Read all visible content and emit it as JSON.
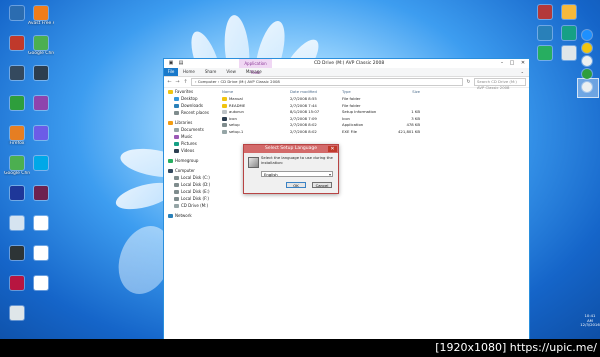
{
  "desktop": {
    "left_icons": [
      {
        "label": "",
        "icon": "app-icon",
        "color": "#2b6cb0"
      },
      {
        "label": "Avast Free Antivirus",
        "icon": "avast-icon",
        "color": "#f07d1a"
      },
      {
        "label": "",
        "icon": "app-icon",
        "color": "#c0392b"
      },
      {
        "label": "Google Chrome",
        "icon": "chrome-icon",
        "color": "#4caf50"
      },
      {
        "label": "",
        "icon": "app-icon",
        "color": "#34495e"
      },
      {
        "label": "",
        "icon": "app-icon",
        "color": "#2c3e50"
      },
      {
        "label": "",
        "icon": "utorrent-icon",
        "color": "#2e9e3c"
      },
      {
        "label": "",
        "icon": "app-icon",
        "color": "#8e44ad"
      },
      {
        "label": "Firefox",
        "icon": "firefox-icon",
        "color": "#e67e22"
      },
      {
        "label": "",
        "icon": "app-icon",
        "color": "#6c5ce7"
      },
      {
        "label": "Google Chrome",
        "icon": "chrome-icon",
        "color": "#4caf50"
      },
      {
        "label": "",
        "icon": "app-icon",
        "color": "#00a8e8"
      },
      {
        "label": "",
        "icon": "app-icon",
        "color": "#1e3799"
      },
      {
        "label": "",
        "icon": "app-icon",
        "color": "#6d214f"
      },
      {
        "label": "",
        "icon": "app-icon",
        "color": "#d6e4f0"
      },
      {
        "label": "",
        "icon": "folder-icon",
        "color": "#ffffff"
      },
      {
        "label": "",
        "icon": "app-icon",
        "color": "#2d3436"
      },
      {
        "label": "",
        "icon": "folder-icon",
        "color": "#ffffff"
      },
      {
        "label": "",
        "icon": "app-icon",
        "color": "#b71540"
      },
      {
        "label": "",
        "icon": "folder-icon",
        "color": "#ffffff"
      },
      {
        "label": "",
        "icon": "recycle-bin-icon",
        "color": "#dfe6e9"
      }
    ],
    "right_icons": [
      {
        "icon": "game-icon",
        "color": "#b33939"
      },
      {
        "icon": "app-icon",
        "color": "#f6b93b"
      },
      {
        "icon": "app-icon",
        "color": "#2980b9"
      },
      {
        "icon": "app-icon",
        "color": "#16a085"
      },
      {
        "icon": "app-icon",
        "color": "#27ae60"
      },
      {
        "icon": "app-icon",
        "color": "#dfe6e9"
      }
    ],
    "taskbar": [
      {
        "icon": "ie-icon",
        "color": "#1e90ff"
      },
      {
        "icon": "folder-icon",
        "color": "#f1c40f"
      },
      {
        "icon": "app-icon",
        "color": "#ecf0f1"
      },
      {
        "icon": "utorrent-icon",
        "color": "#2e9e3c"
      },
      {
        "icon": "app-icon",
        "color": "#ecf0f1"
      }
    ],
    "clock": {
      "time": "10:41",
      "period": "AM",
      "date": "12/3/2016"
    }
  },
  "explorer": {
    "context_tab": "Application Tools",
    "title": "CD Drive (M:) AVP Classic 2008",
    "ribbon_tabs": [
      "File",
      "Home",
      "Share",
      "View",
      "Manage"
    ],
    "address": "› Computer › CD Drive (M:) AVP Classic 2008",
    "search_placeholder": "Search CD Drive (M:) AVP Classic 2008",
    "nav": [
      {
        "label": "Favorites",
        "icon": "star-icon",
        "color": "#f1c40f"
      },
      {
        "label": "Desktop",
        "icon": "desktop-icon",
        "color": "#3498db"
      },
      {
        "label": "Downloads",
        "icon": "download-icon",
        "color": "#2980b9"
      },
      {
        "label": "Recent places",
        "icon": "recent-icon",
        "color": "#7f8c8d"
      },
      {
        "label": "",
        "icon": "",
        "color": ""
      },
      {
        "label": "Libraries",
        "icon": "library-icon",
        "color": "#f39c12"
      },
      {
        "label": "Documents",
        "icon": "documents-icon",
        "color": "#95a5a6"
      },
      {
        "label": "Music",
        "icon": "music-icon",
        "color": "#9b59b6"
      },
      {
        "label": "Pictures",
        "icon": "pictures-icon",
        "color": "#16a085"
      },
      {
        "label": "Videos",
        "icon": "videos-icon",
        "color": "#2c3e50"
      },
      {
        "label": "",
        "icon": "",
        "color": ""
      },
      {
        "label": "Homegroup",
        "icon": "homegroup-icon",
        "color": "#27ae60"
      },
      {
        "label": "",
        "icon": "",
        "color": ""
      },
      {
        "label": "Computer",
        "icon": "computer-icon",
        "color": "#34495e"
      },
      {
        "label": "Local Disk (C:)",
        "icon": "disk-icon",
        "color": "#7f8c8d"
      },
      {
        "label": "Local Disk (D:)",
        "icon": "disk-icon",
        "color": "#7f8c8d"
      },
      {
        "label": "Local Disk (E:)",
        "icon": "disk-icon",
        "color": "#7f8c8d"
      },
      {
        "label": "Local Disk (F:)",
        "icon": "disk-icon",
        "color": "#7f8c8d"
      },
      {
        "label": "CD Drive (M:)",
        "icon": "cd-icon",
        "color": "#95a5a6"
      },
      {
        "label": "",
        "icon": "",
        "color": ""
      },
      {
        "label": "Network",
        "icon": "network-icon",
        "color": "#2980b9"
      }
    ],
    "columns": [
      "Name",
      "Date modified",
      "Type",
      "Size"
    ],
    "files": [
      {
        "name": "Manual",
        "date": "2/7/2008 8:55",
        "type": "File folder",
        "size": "",
        "icon": "folder-icon",
        "color": "#f1c40f"
      },
      {
        "name": "README",
        "date": "2/7/2008 7:44",
        "type": "File folder",
        "size": "",
        "icon": "folder-icon",
        "color": "#f1c40f"
      },
      {
        "name": "autorun",
        "date": "8/1/2008 15:07",
        "type": "Setup Information",
        "size": "1 KB",
        "icon": "inf-icon",
        "color": "#bdc3c7"
      },
      {
        "name": "icon",
        "date": "2/7/2008 7:09",
        "type": "Icon",
        "size": "3 KB",
        "icon": "ico-icon",
        "color": "#2c3e50"
      },
      {
        "name": "setup",
        "date": "2/7/2008 8:02",
        "type": "Application",
        "size": "478 KB",
        "icon": "setup-icon",
        "color": "#7f8c8d"
      },
      {
        "name": "setup.1",
        "date": "2/7/2008 8:02",
        "type": "EXE File",
        "size": "421,801 KB",
        "icon": "exe-icon",
        "color": "#95a5a6"
      }
    ]
  },
  "dialog": {
    "title": "Select Setup Language",
    "message": "Select the language to use during the installation:",
    "selected_language": "English",
    "ok_label": "OK",
    "cancel_label": "Cancel"
  },
  "watermark": "[1920x1080] https://upic.me/"
}
